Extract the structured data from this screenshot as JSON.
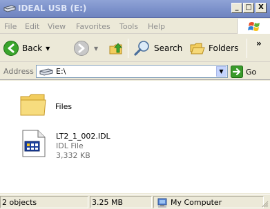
{
  "window": {
    "title": "IDEAL USB (E:)",
    "controls": {
      "minimize": "_",
      "maximize": "□",
      "close": "X"
    }
  },
  "menu": {
    "items": [
      "File",
      "Edit",
      "View",
      "Favorites",
      "Tools",
      "Help"
    ]
  },
  "toolbar": {
    "back_label": "Back",
    "search_label": "Search",
    "folders_label": "Folders",
    "more": "»"
  },
  "address": {
    "label": "Address",
    "value": "E:\\",
    "go_label": "Go"
  },
  "content": {
    "items": [
      {
        "name": "Files",
        "type": "folder"
      },
      {
        "name": "LT2_1_002.IDL",
        "type_label": "IDL File",
        "size": "3,332 KB"
      }
    ]
  },
  "status": {
    "objects": "2 objects",
    "size": "3.25 MB",
    "zone": "My Computer"
  },
  "colors": {
    "titlebar_inactive": "#7a8fc9",
    "chrome": "#ece9d8",
    "go_green": "#3a9a2b"
  }
}
